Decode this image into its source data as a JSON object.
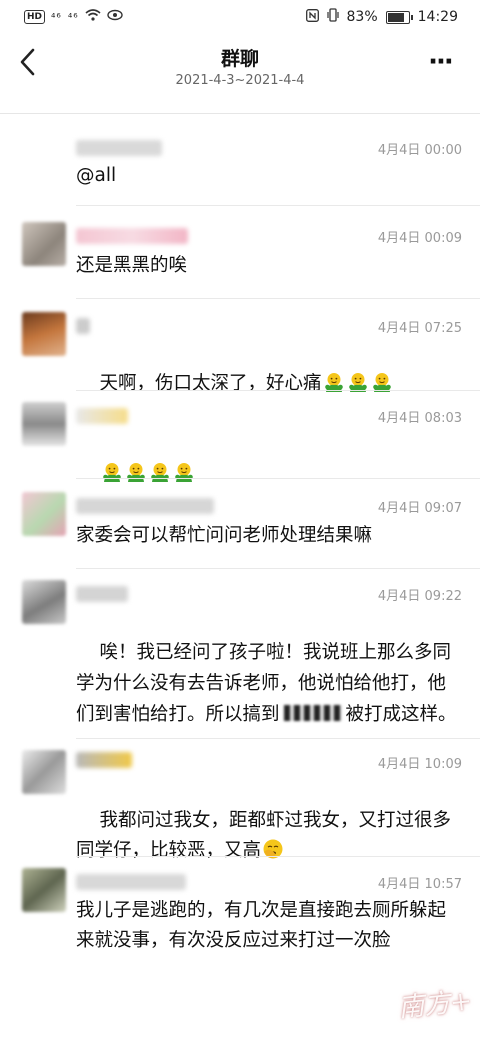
{
  "status_bar": {
    "hd": "HD",
    "signal1": "⁴⁶",
    "signal2": "⁴⁶",
    "battery_text": "83%",
    "battery_level": 0.83,
    "time": "14:29"
  },
  "header": {
    "title": "群聊",
    "subtitle": "2021-4-3~2021-4-4",
    "back_icon": "chevron-left-icon",
    "more_icon": "more-dots-icon",
    "more_label": "···"
  },
  "messages": [
    {
      "time": "4月4日 00:00",
      "text": "@all"
    },
    {
      "time": "4月4日 00:09",
      "text": "还是黑黑的唉"
    },
    {
      "time": "4月4日 07:25",
      "text": "天啊，伤口太深了，好心痛"
    },
    {
      "time": "4月4日 08:03",
      "text": ""
    },
    {
      "time": "4月4日 09:07",
      "text": "家委会可以帮忙问问老师处理结果嘛"
    },
    {
      "time": "4月4日 09:22",
      "text_part1": "唉！我已经问了孩子啦！我说班上那么多同学为什么没有去告诉老师，他说怕给他打，他们到害怕给打。所以搞到",
      "text_part2": "被打成这样。"
    },
    {
      "time": "4月4日 10:09",
      "text": "我都问过我女，距都虾过我女，又打过很多同学仔，比较恶，又高"
    },
    {
      "time": "4月4日 10:57",
      "text": "我儿子是逃跑的，有几次是直接跑去厕所躲起来就没事，有次没反应过来打过一次脸"
    }
  ],
  "emoji_names": {
    "hug": "hugging-emoji",
    "facepalm": "facepalm-emoji"
  },
  "watermark": "南方+",
  "colors": {
    "timestamp": "#9a9a9a",
    "divider": "#e9e9e9",
    "emoji_green": "#3aa335",
    "emoji_yellow": "#f5c61b"
  }
}
